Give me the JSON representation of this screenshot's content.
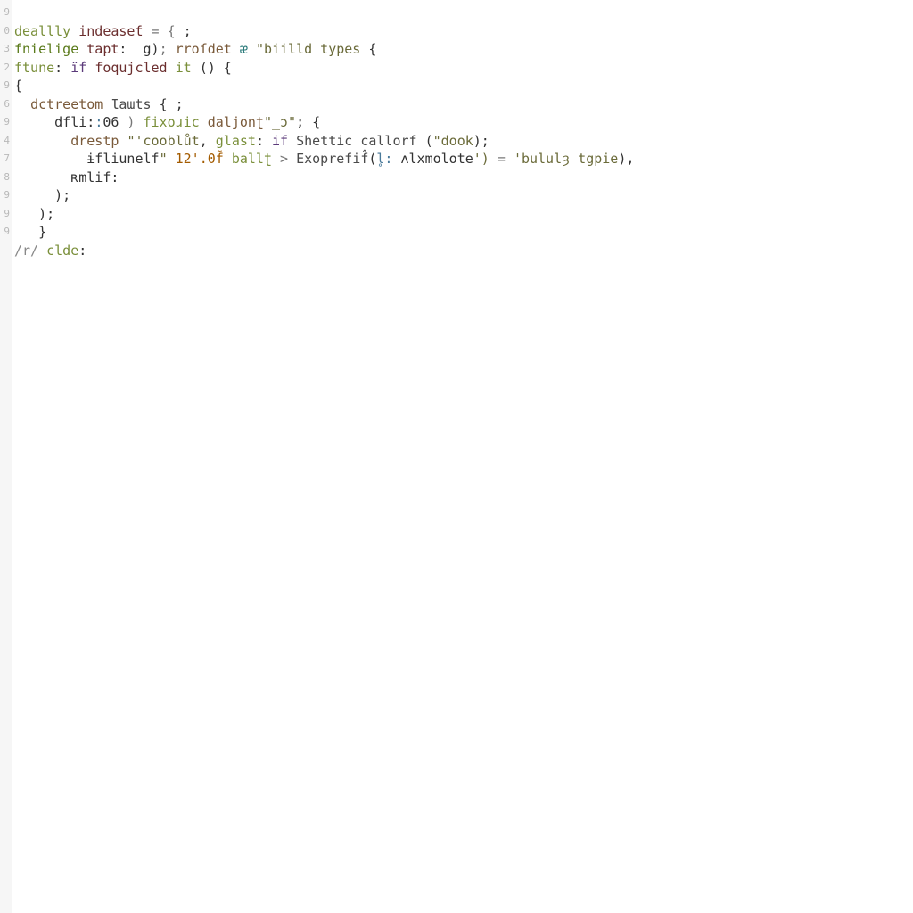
{
  "gutter": [
    "",
    "9",
    "0",
    "3",
    "2",
    "9",
    "6",
    "9",
    "4",
    "7",
    "8",
    "9",
    "9",
    "9",
    "",
    "",
    "",
    "",
    "",
    "",
    "",
    "",
    "",
    "",
    "",
    "",
    "",
    "",
    "",
    "",
    "",
    "",
    "",
    "",
    "",
    "",
    "",
    "",
    "",
    "",
    "",
    "",
    "",
    "",
    "",
    "",
    "",
    "",
    "",
    ""
  ],
  "lines": [
    {
      "segments": []
    },
    {
      "segments": [
        {
          "cls": "kw",
          "t": "deallly "
        },
        {
          "cls": "darkred",
          "t": "indeaseƭ"
        },
        {
          "cls": "op",
          "t": " = { "
        },
        {
          "cls": "id",
          "t": ";"
        }
      ]
    },
    {
      "segments": [
        {
          "cls": "kw2",
          "t": "fnielige "
        },
        {
          "cls": "darkred",
          "t": "tapt"
        },
        {
          "cls": "id",
          "t": ":  "
        },
        {
          "cls": "id",
          "t": "g)"
        },
        {
          "cls": "op",
          "t": "; "
        },
        {
          "cls": "brown",
          "t": "rroſdet "
        },
        {
          "cls": "teal",
          "t": "ᴂ "
        },
        {
          "cls": "str",
          "t": "\"biilld types "
        },
        {
          "cls": "id",
          "t": "{"
        }
      ]
    },
    {
      "segments": [
        {
          "cls": "kw",
          "t": "ftune"
        },
        {
          "cls": "id",
          "t": ": "
        },
        {
          "cls": "purple",
          "t": "ḯf "
        },
        {
          "cls": "darkred",
          "t": "foqujcled "
        },
        {
          "cls": "kw",
          "t": "it "
        },
        {
          "cls": "id",
          "t": "() {"
        }
      ]
    },
    {
      "segments": [
        {
          "cls": "id",
          "t": "{"
        }
      ]
    },
    {
      "segments": [
        {
          "cls": "id",
          "t": "  "
        },
        {
          "cls": "brown",
          "t": "dctreetom "
        },
        {
          "cls": "fn",
          "t": "Ɩaɯts "
        },
        {
          "cls": "id",
          "t": "{ ;"
        }
      ]
    },
    {
      "segments": [
        {
          "cls": "id",
          "t": "     "
        },
        {
          "cls": "id",
          "t": "dfli:"
        },
        {
          "cls": "type",
          "t": ":"
        },
        {
          "cls": "id",
          "t": "06"
        },
        {
          "cls": "op",
          "t": " ) "
        },
        {
          "cls": "kw",
          "t": "fixoɹic "
        },
        {
          "cls": "brown",
          "t": "daljonʈ"
        },
        {
          "cls": "str",
          "t": "\"_ɔ\""
        },
        {
          "cls": "id",
          "t": "; {"
        }
      ]
    },
    {
      "segments": [
        {
          "cls": "id",
          "t": "       "
        },
        {
          "cls": "brown",
          "t": "drestp "
        },
        {
          "cls": "str",
          "t": "\"'cooblůt"
        },
        {
          "cls": "id",
          "t": ", "
        },
        {
          "cls": "kw",
          "t": "glast"
        },
        {
          "cls": "id",
          "t": ": "
        },
        {
          "cls": "purple",
          "t": "if "
        },
        {
          "cls": "fn",
          "t": "Shettic callorf "
        },
        {
          "cls": "id",
          "t": "("
        },
        {
          "cls": "str",
          "t": "\"dook"
        },
        {
          "cls": "id",
          "t": ");"
        }
      ]
    },
    {
      "segments": [
        {
          "cls": "id",
          "t": "         "
        },
        {
          "cls": "id",
          "t": "ɨfliunelf"
        },
        {
          "cls": "str",
          "t": "\" "
        },
        {
          "cls": "num",
          "t": "12'.0f̃ "
        },
        {
          "cls": "kw",
          "t": "ballʈ "
        },
        {
          "cls": "op",
          "t": "> "
        },
        {
          "cls": "fn",
          "t": "Exoprefif̂"
        },
        {
          "cls": "id",
          "t": "("
        },
        {
          "cls": "type",
          "t": "l̥: "
        },
        {
          "cls": "id",
          "t": "ʌlxmolote"
        },
        {
          "cls": "str",
          "t": "') "
        },
        {
          "cls": "op",
          "t": "= "
        },
        {
          "cls": "str",
          "t": "'bululȝ tgpie"
        },
        {
          "cls": "id",
          "t": "),"
        }
      ]
    },
    {
      "segments": [
        {
          "cls": "id",
          "t": "       "
        },
        {
          "cls": "id",
          "t": "ʀmlif:"
        }
      ]
    },
    {
      "segments": [
        {
          "cls": "id",
          "t": "     );"
        }
      ]
    },
    {
      "segments": [
        {
          "cls": "id",
          "t": "   );"
        }
      ]
    },
    {
      "segments": [
        {
          "cls": "id",
          "t": "   }"
        }
      ]
    },
    {
      "segments": [
        {
          "cls": "cmt",
          "t": "/r/ "
        },
        {
          "cls": "kw",
          "t": "clde"
        },
        {
          "cls": "id",
          "t": ":"
        }
      ]
    }
  ]
}
